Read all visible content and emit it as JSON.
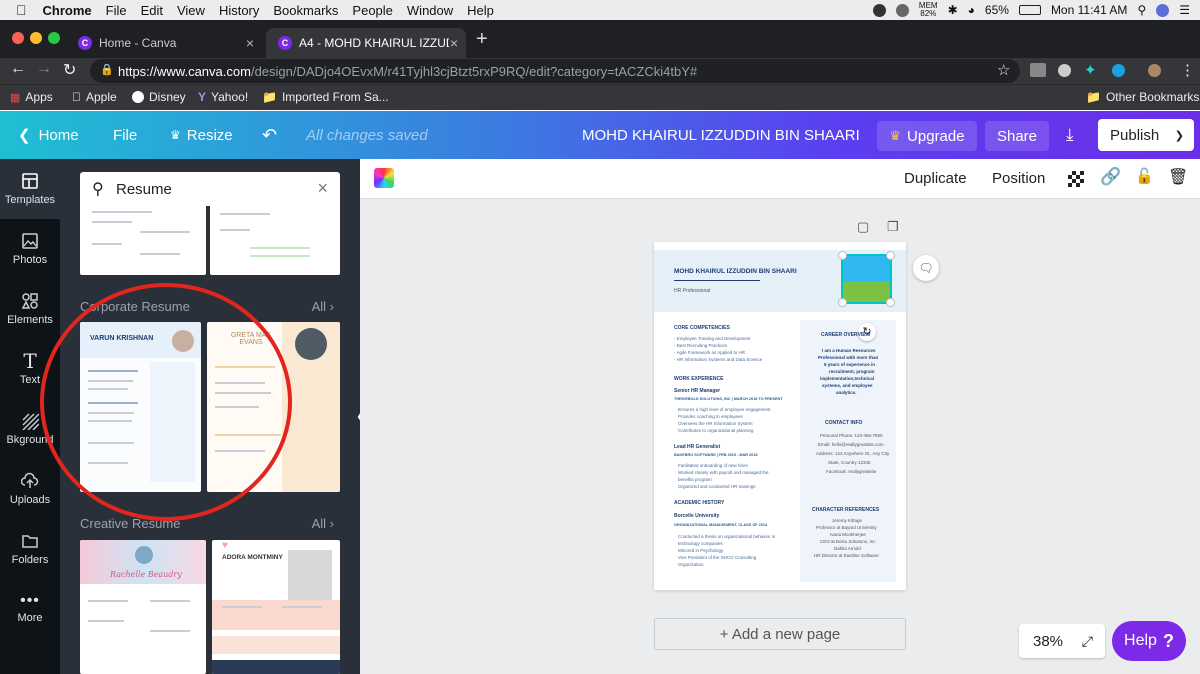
{
  "mac": {
    "menus": [
      "Chrome",
      "File",
      "Edit",
      "View",
      "History",
      "Bookmarks",
      "People",
      "Window",
      "Help"
    ],
    "mem": "MEM",
    "mem_pct": "82%",
    "battery": "65%",
    "clock": "Mon 11:41 AM"
  },
  "browser": {
    "tabs": [
      {
        "title": "Home - Canva"
      },
      {
        "title": "A4 - MOHD KHAIRUL IZZUDDI"
      }
    ],
    "url_host": "https://www.canva.com",
    "url_path": "/design/DADjo4OEvxM/r41Tyjhl3cjBtzt5rxP9RQ/edit?category=tACZCki4tbY#",
    "bookmarks": [
      "Apps",
      "Apple",
      "Disney",
      "Yahoo!",
      "Imported From Sa..."
    ],
    "other_bookmarks": "Other Bookmarks"
  },
  "header": {
    "home": "Home",
    "file": "File",
    "resize": "Resize",
    "saved": "All changes saved",
    "doc_title": "MOHD KHAIRUL IZZUDDIN BIN SHAARI",
    "upgrade": "Upgrade",
    "share": "Share",
    "publish": "Publish"
  },
  "rail": [
    "Templates",
    "Photos",
    "Elements",
    "Text",
    "Bkground",
    "Uploads",
    "Folders",
    "More"
  ],
  "panel": {
    "search_value": "Resume",
    "sections": [
      {
        "title": "Corporate Resume",
        "all": "All"
      },
      {
        "title": "Creative Resume",
        "all": "All"
      }
    ],
    "thumbs": {
      "varun": "VARUN KRISHNAN",
      "greta": "GRETA MAE EVANS",
      "rachelle": "Rachelle Beaudry",
      "adora": "ADORA MONTMINY"
    }
  },
  "toolbar": {
    "duplicate": "Duplicate",
    "position": "Position"
  },
  "resume": {
    "name": "MOHD KHAIRUL IZZUDDIN BIN SHAARI",
    "role": "HR Professional",
    "core": "CORE COMPETENCIES",
    "core_items": [
      "- Employee Training and Development",
      "- Best Recruiting Practices",
      "- Agile Framework as Applied to HR",
      "- HR Information Systems and Data Science"
    ],
    "work": "WORK EXPERIENCE",
    "job1": "Senior HR Manager",
    "job1_co": "THRIVEBOLD SOLUTIONS, INC | MARCH 2018 TO PRESENT",
    "job1_items": [
      "Ensures a high level of employee engagement",
      "Provides coaching to employees",
      "Oversees the HR Information System",
      "Contributes to organizational planning"
    ],
    "job2": "Lead HR Generalist",
    "job2_co": "BAKEBRO SOFTWARE | FEB 2015 - MAR 2018",
    "job2_items": [
      "Facilitated onboarding of new hires",
      "Worked closely with payroll and managed the",
      "benefits program",
      "Organized and conducted HR trainings"
    ],
    "academic": "ACADEMIC HISTORY",
    "school": "Borcelle University",
    "school_sub": "ORGANIZATIONAL MANAGEMENT, CLASS OF 2014",
    "acad_items": [
      "Conducted a thesis on organizational behavior in",
      "technology companies",
      "Minored in Psychology",
      "Vice President of the SHCG Consulting",
      "Organization"
    ],
    "career": "CAREER OVERVIEW",
    "career_text": [
      "I am a Human Resources",
      "Professional with more than",
      "5 years of experience in",
      "recruitment, program",
      "implementation,technical",
      "systems, and employee",
      "analytics."
    ],
    "contact": "CONTACT INFO",
    "contact_items": [
      "Personal Phone: 123-456-7890",
      "Email: hello@reallygreatsite.com",
      "Address: 123 Anywhere St., Any City",
      "State, Country 12345",
      "Facebook: reallygreatsite"
    ],
    "refs": "CHARACTER REFERENCES",
    "ref_items": [
      "Jeremy Kittage",
      "Professor at Bayard University",
      "Ivana Mookherjee",
      "CEO at Bolsu Solutions, Inc",
      "Dahlia Arnold",
      "HR Director at Eastline Software"
    ]
  },
  "add_page": "+ Add a new page",
  "zoom": "38%",
  "help": "Help",
  "help_icon": "?"
}
